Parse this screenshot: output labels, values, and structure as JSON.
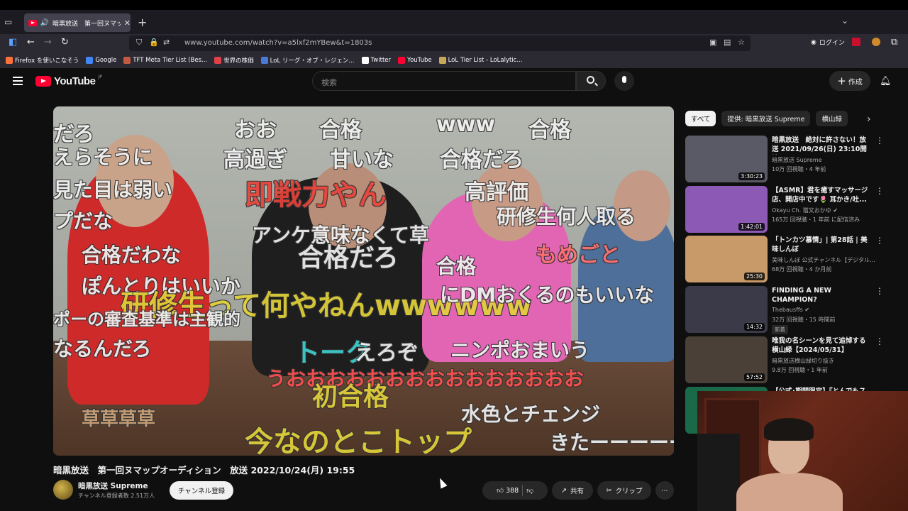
{
  "browser": {
    "tab_title": "暗黒放送　第一回ヌマップオ",
    "url": "www.youtube.com/watch?v=a5lxf2mYBew&t=1803s",
    "login_label": "ログイン",
    "bookmarks": [
      {
        "label": "Firefox を使いこなそう",
        "color": "#ff7139"
      },
      {
        "label": "Google",
        "color": "#4285f4"
      },
      {
        "label": "TFT Meta Tier List (Bes...",
        "color": "#c25b3f"
      },
      {
        "label": "世界の株価",
        "color": "#e0404a"
      },
      {
        "label": "LoL リーグ・オブ・レジェン...",
        "color": "#4a7ad8"
      },
      {
        "label": "Twitter",
        "color": "#ffffff"
      },
      {
        "label": "YouTube",
        "color": "#ff0033"
      },
      {
        "label": "LoL Tier List - LoLalytic...",
        "color": "#c8a858"
      }
    ]
  },
  "header": {
    "logo_text": "YouTube",
    "logo_region": "JP",
    "search_placeholder": "検索",
    "create_label": "作成"
  },
  "video": {
    "overlay_comments": [
      {
        "text": "だろ",
        "color": "#f1f1f1"
      },
      {
        "text": "おお",
        "color": "#f1f1f1"
      },
      {
        "text": "合格",
        "color": "#f1f1f1"
      },
      {
        "text": "www",
        "color": "#f1f1f1"
      },
      {
        "text": "合格",
        "color": "#f1f1f1"
      },
      {
        "text": "えらそうに",
        "color": "#f1f1f1"
      },
      {
        "text": "高過ぎ",
        "color": "#f1f1f1"
      },
      {
        "text": "甘いな",
        "color": "#f1f1f1"
      },
      {
        "text": "合格だろ",
        "color": "#f1f1f1"
      },
      {
        "text": "見た目は弱い",
        "color": "#f1f1f1"
      },
      {
        "text": "即戦力やん",
        "color": "#e8433a"
      },
      {
        "text": "高評価",
        "color": "#f1f1f1"
      },
      {
        "text": "研修生何人取る",
        "color": "#f1f1f1"
      },
      {
        "text": "プだな",
        "color": "#f1f1f1"
      },
      {
        "text": "アンケ意味なくて草",
        "color": "#f1f1f1"
      },
      {
        "text": "合格だわな",
        "color": "#f1f1f1"
      },
      {
        "text": "合格だろ",
        "color": "#f1f1f1"
      },
      {
        "text": "もめごと",
        "color": "#ff7070"
      },
      {
        "text": "合格",
        "color": "#f1f1f1"
      },
      {
        "text": "ぽんとりはいいか",
        "color": "#f1f1f1"
      },
      {
        "text": "研修生って何やねんwwwwww",
        "color": "#e2d23a"
      },
      {
        "text": "にDMおくるのもいいな",
        "color": "#f1f1f1"
      },
      {
        "text": "ポーの審査基準は主観的",
        "color": "#f1f1f1"
      },
      {
        "text": "なるんだろ",
        "color": "#f1f1f1"
      },
      {
        "text": "トーク",
        "color": "#3fd0d0"
      },
      {
        "text": "えろぞ",
        "color": "#f1f1f1"
      },
      {
        "text": "ニンポおまいう",
        "color": "#f1f1f1"
      },
      {
        "text": "うおおおおおおおおおおおおおおお",
        "color": "#ff5050"
      },
      {
        "text": "初合格",
        "color": "#e2d23a"
      },
      {
        "text": "水色とチェンジ",
        "color": "#f1f1f1"
      },
      {
        "text": "草草草草",
        "color": "#c9a27a"
      },
      {
        "text": "今なのとこトップ",
        "color": "#e2d23a"
      },
      {
        "text": "きたーーーーー",
        "color": "#f1f1f1"
      }
    ],
    "title": "暗黒放送　第一回ヌマップオーディション　放送 2022/10/24(月) 19:55",
    "channel_name": "暗黒放送 Supreme",
    "subscriber_text": "チャンネル登録者数 2.51万人",
    "subscribe_label": "チャンネル登録",
    "like_count": "388",
    "share_label": "共有",
    "clip_label": "クリップ"
  },
  "sidebar": {
    "chips": [
      "すべて",
      "提供: 暗黒放送 Supreme",
      "横山緑"
    ],
    "recommendations": [
      {
        "title": "暗黒放送　絶対に許さない！放送 2021/09/26(日) 23:10開始",
        "channel": "暗黒放送 Supreme",
        "meta": "10万 回視聴・4 年前",
        "duration": "3:30:23",
        "thumb": "#5a5a66",
        "badge": ""
      },
      {
        "title": "【ASMR】君を癒すマッサージ店、開店中です🌷 耳かき/吐...",
        "channel": "Okayu Ch. 猫又おかゆ ✔",
        "meta": "165万 回視聴・1 年前 に配信済み",
        "duration": "1:42:01",
        "thumb": "#8c5ab4",
        "badge": ""
      },
      {
        "title": "「トンカツ慕情」| 第28話 | 美味しんぼ",
        "channel": "美味しんぼ 公式チャンネル【デジタル...",
        "meta": "68万 回視聴・4 か月前",
        "duration": "25:30",
        "thumb": "#c89a6a",
        "badge": ""
      },
      {
        "title": "FINDING A NEW CHAMPION?",
        "channel": "Thebausffs ✔",
        "meta": "32万 回視聴・15 時間前",
        "duration": "14:32",
        "thumb": "#3a3a48",
        "badge": "新着"
      },
      {
        "title": "唯我の名シーンを見て追悼する横山緑【2024/05/31】",
        "channel": "暗黒放送横山緑切り抜き",
        "meta": "9.8万 回視聴・1 年前",
        "duration": "57:52",
        "thumb": "#4a4038",
        "badge": ""
      },
      {
        "title": "【公式･期間限定】『とんでもス",
        "channel": "",
        "meta": "",
        "duration": "",
        "thumb": "#1a6a4a",
        "badge": ""
      }
    ]
  }
}
